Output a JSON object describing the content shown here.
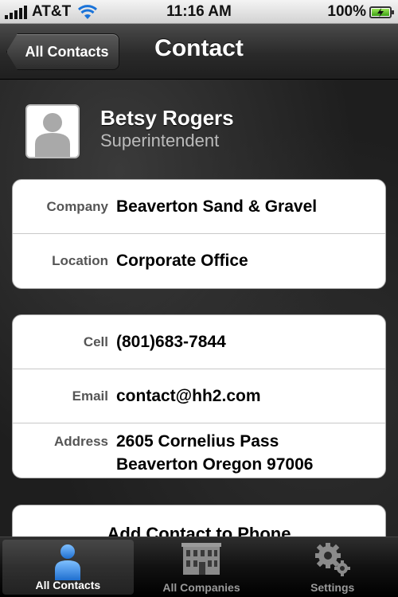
{
  "status_bar": {
    "carrier": "AT&T",
    "time": "11:16 AM",
    "battery": "100%"
  },
  "nav": {
    "back_label": "All Contacts",
    "title": "Contact"
  },
  "contact": {
    "name": "Betsy Rogers",
    "title": "Superintendent"
  },
  "org_group": [
    {
      "label": "Company",
      "value": "Beaverton Sand & Gravel"
    },
    {
      "label": "Location",
      "value": "Corporate Office"
    }
  ],
  "contact_group": {
    "cell": {
      "label": "Cell",
      "value": "(801)683-7844"
    },
    "email": {
      "label": "Email",
      "value": "contact@hh2.com"
    },
    "address": {
      "label": "Address",
      "line1": "2605 Cornelius Pass",
      "line2": "Beaverton Oregon 97006"
    }
  },
  "actions": {
    "add_to_phone": "Add Contact to Phone"
  },
  "tabs": [
    {
      "label": "All Contacts",
      "icon": "person-icon",
      "active": true
    },
    {
      "label": "All Companies",
      "icon": "building-icon",
      "active": false
    },
    {
      "label": "Settings",
      "icon": "gears-icon",
      "active": false
    }
  ],
  "colors": {
    "tab_active_icon": "#3a8fe0",
    "battery_fill": "#3aa012"
  }
}
